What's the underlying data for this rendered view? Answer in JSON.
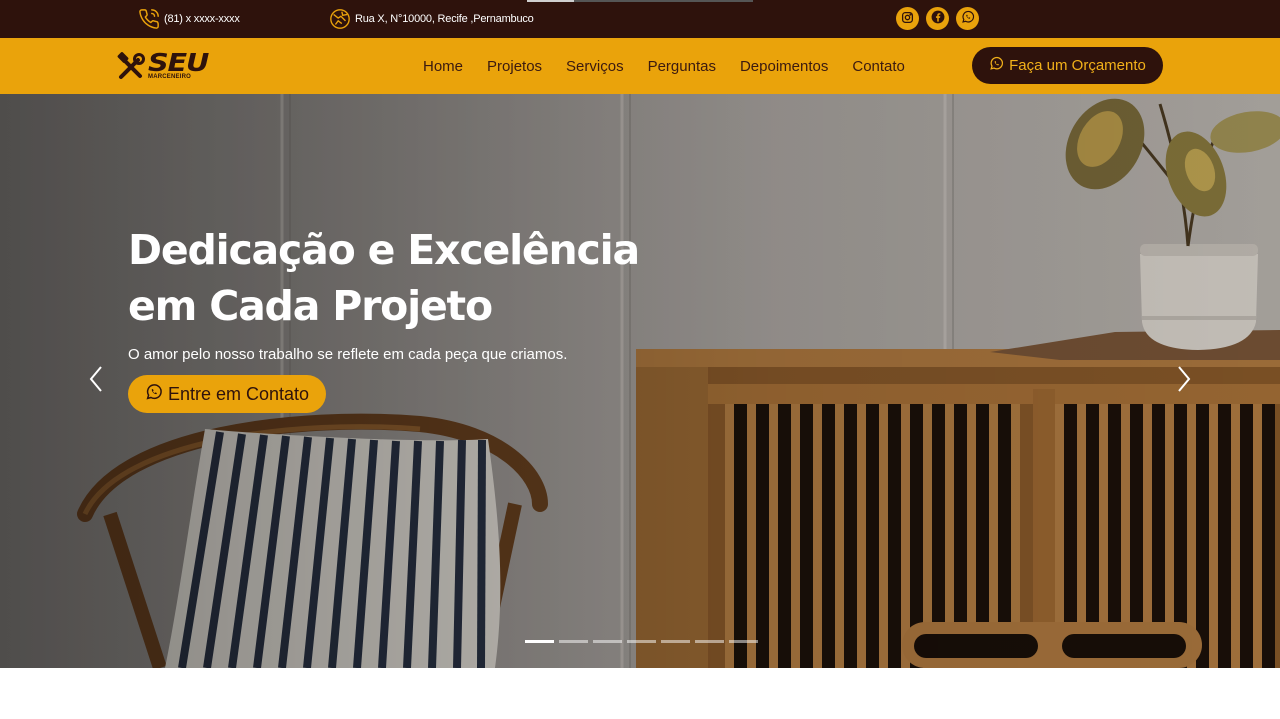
{
  "topbar": {
    "phone": "(81) x xxxx-xxxx",
    "address": "Rua X, N°10000, Recife ,Pernambuco",
    "socials": [
      "instagram-icon",
      "facebook-icon",
      "whatsapp-icon"
    ]
  },
  "logo": {
    "word": "SEU",
    "sub": "MARCENEIRO"
  },
  "nav": {
    "items": [
      "Home",
      "Projetos",
      "Serviços",
      "Perguntas",
      "Depoimentos",
      "Contato"
    ],
    "cta_label": "Faça um Orçamento"
  },
  "hero": {
    "title_line1": "Dedicação e Excelência",
    "title_line2": "em Cada Projeto",
    "subtitle": "O amor pelo nosso trabalho se reflete em cada peça que criamos.",
    "cta_label": "Entre em Contato",
    "slide_count": 7,
    "active_slide": 1
  },
  "colors": {
    "topbar_bg": "#2e120c",
    "accent": "#eaa30b",
    "dark_brown": "#2e120c"
  }
}
